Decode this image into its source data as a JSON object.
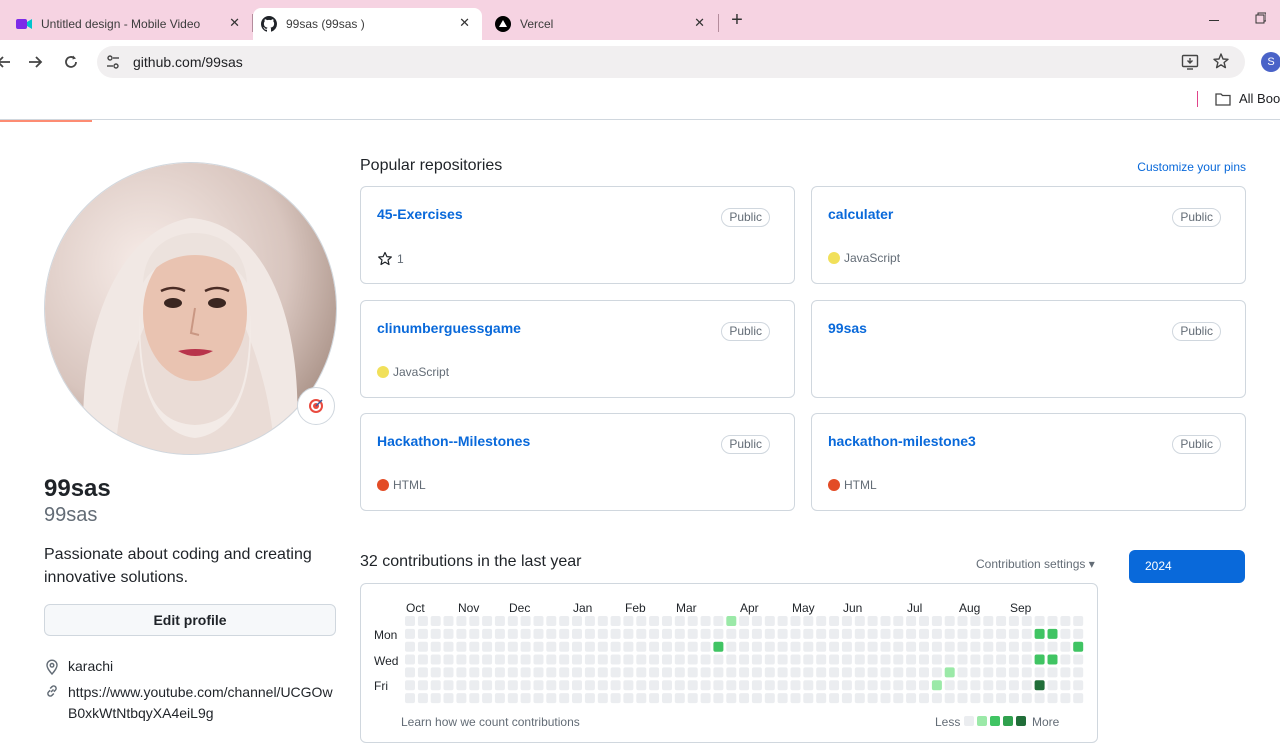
{
  "browser": {
    "tabs": [
      {
        "title": "Untitled design - Mobile Video",
        "icon": "video-camera-icon"
      },
      {
        "title": "99sas (99sas )",
        "icon": "github-icon"
      },
      {
        "title": "Vercel",
        "icon": "vercel-icon"
      }
    ],
    "active_tab": 1,
    "url": "github.com/99sas",
    "profile_initial": "S",
    "bookmarks_label": "All Bookmarks"
  },
  "profile": {
    "name": "99sas",
    "login": "99sas",
    "bio": "Passionate about coding and creating innovative solutions.",
    "edit_label": "Edit profile",
    "location": "karachi",
    "link": "https://www.youtube.com/channel/UCGOwB0xkWtNtbqyXA4eiL9g"
  },
  "popular": {
    "title": "Popular repositories",
    "customize_label": "Customize your pins",
    "repos": [
      {
        "name": "45-Exercises",
        "visibility": "Public",
        "stars": "1",
        "language": "",
        "lang_color": ""
      },
      {
        "name": "calculater",
        "visibility": "Public",
        "stars": "",
        "language": "JavaScript",
        "lang_color": "#f1e05a"
      },
      {
        "name": "clinumberguessgame",
        "visibility": "Public",
        "stars": "",
        "language": "JavaScript",
        "lang_color": "#f1e05a"
      },
      {
        "name": "99sas",
        "visibility": "Public",
        "stars": "",
        "language": "",
        "lang_color": ""
      },
      {
        "name": "Hackathon--Milestones",
        "visibility": "Public",
        "stars": "",
        "language": "HTML",
        "lang_color": "#e34c26"
      },
      {
        "name": "hackathon-milestone3",
        "visibility": "Public",
        "stars": "",
        "language": "HTML",
        "lang_color": "#e34c26"
      }
    ]
  },
  "contributions": {
    "title": "32 contributions in the last year",
    "settings_label": "Contribution settings",
    "year": "2024",
    "months": [
      "Oct",
      "Nov",
      "Dec",
      "Jan",
      "Feb",
      "Mar",
      "Apr",
      "May",
      "Jun",
      "Jul",
      "Aug",
      "Sep"
    ],
    "days": [
      "Mon",
      "Wed",
      "Fri"
    ],
    "learn_label": "Learn how we count contributions",
    "less_label": "Less",
    "more_label": "More",
    "colors": {
      "empty": "#ebedf0",
      "l1": "#9be9a8",
      "l2": "#40c463",
      "l3": "#30a14e",
      "l4": "#216e39"
    },
    "active_cells": [
      {
        "week": 25,
        "day": 0,
        "level": 1
      },
      {
        "week": 24,
        "day": 2,
        "level": 2
      },
      {
        "week": 42,
        "day": 4,
        "level": 1
      },
      {
        "week": 41,
        "day": 5,
        "level": 1
      },
      {
        "week": 49,
        "day": 1,
        "level": 2
      },
      {
        "week": 50,
        "day": 1,
        "level": 2
      },
      {
        "week": 49,
        "day": 3,
        "level": 2
      },
      {
        "week": 50,
        "day": 3,
        "level": 2
      },
      {
        "week": 52,
        "day": 2,
        "level": 2
      },
      {
        "week": 49,
        "day": 5,
        "level": 4
      }
    ]
  }
}
